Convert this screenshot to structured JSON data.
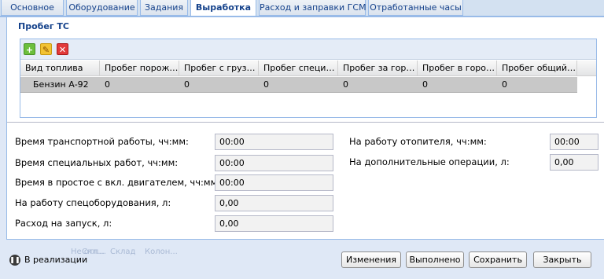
{
  "tabs": [
    "Основное",
    "Оборудование",
    "Задания",
    "Выработка",
    "Расход и заправки ГСМ",
    "Отработанные часы"
  ],
  "active_tab": "Выработка",
  "fieldset": {
    "title": "Пробег ТС",
    "toolbar": {
      "add_icon": "add-icon",
      "edit_icon": "edit-icon",
      "delete_icon": "delete-icon"
    },
    "grid": {
      "columns": [
        "Вид топлива",
        "Пробег порожн...",
        "Пробег с грузом...",
        "Пробег специал...",
        "Пробег за город...",
        "Пробег в город...",
        "Пробег общий, ..."
      ],
      "rows": [
        [
          "Бензин А-92",
          "0",
          "0",
          "0",
          "0",
          "0",
          "0"
        ]
      ]
    }
  },
  "form": {
    "left": [
      {
        "label": "Время транспортной работы, чч:мм:",
        "value": "00:00"
      },
      {
        "label": "Время специальных работ, чч:мм:",
        "value": "00:00"
      },
      {
        "label": "Время в простое с вкл. двигателем, чч:мм:",
        "value": "00:00"
      },
      {
        "label": "На работу спецоборудования, л:",
        "value": "0,00"
      },
      {
        "label": "Расход на запуск, л:",
        "value": "0,00"
      }
    ],
    "right": [
      {
        "label": "На работу отопителя, чч:мм:",
        "value": "00:00"
      },
      {
        "label": "На дополнительные операции, л:",
        "value": "0,00"
      }
    ]
  },
  "background_ghost": [
    "Не отп...",
    "Скл...",
    "Склад",
    "Колон..."
  ],
  "status": {
    "icon": "pause-icon",
    "text": "В реализации"
  },
  "buttons": {
    "changes": "Изменения",
    "done": "Выполнено",
    "save": "Сохранить",
    "close": "Закрыть"
  }
}
